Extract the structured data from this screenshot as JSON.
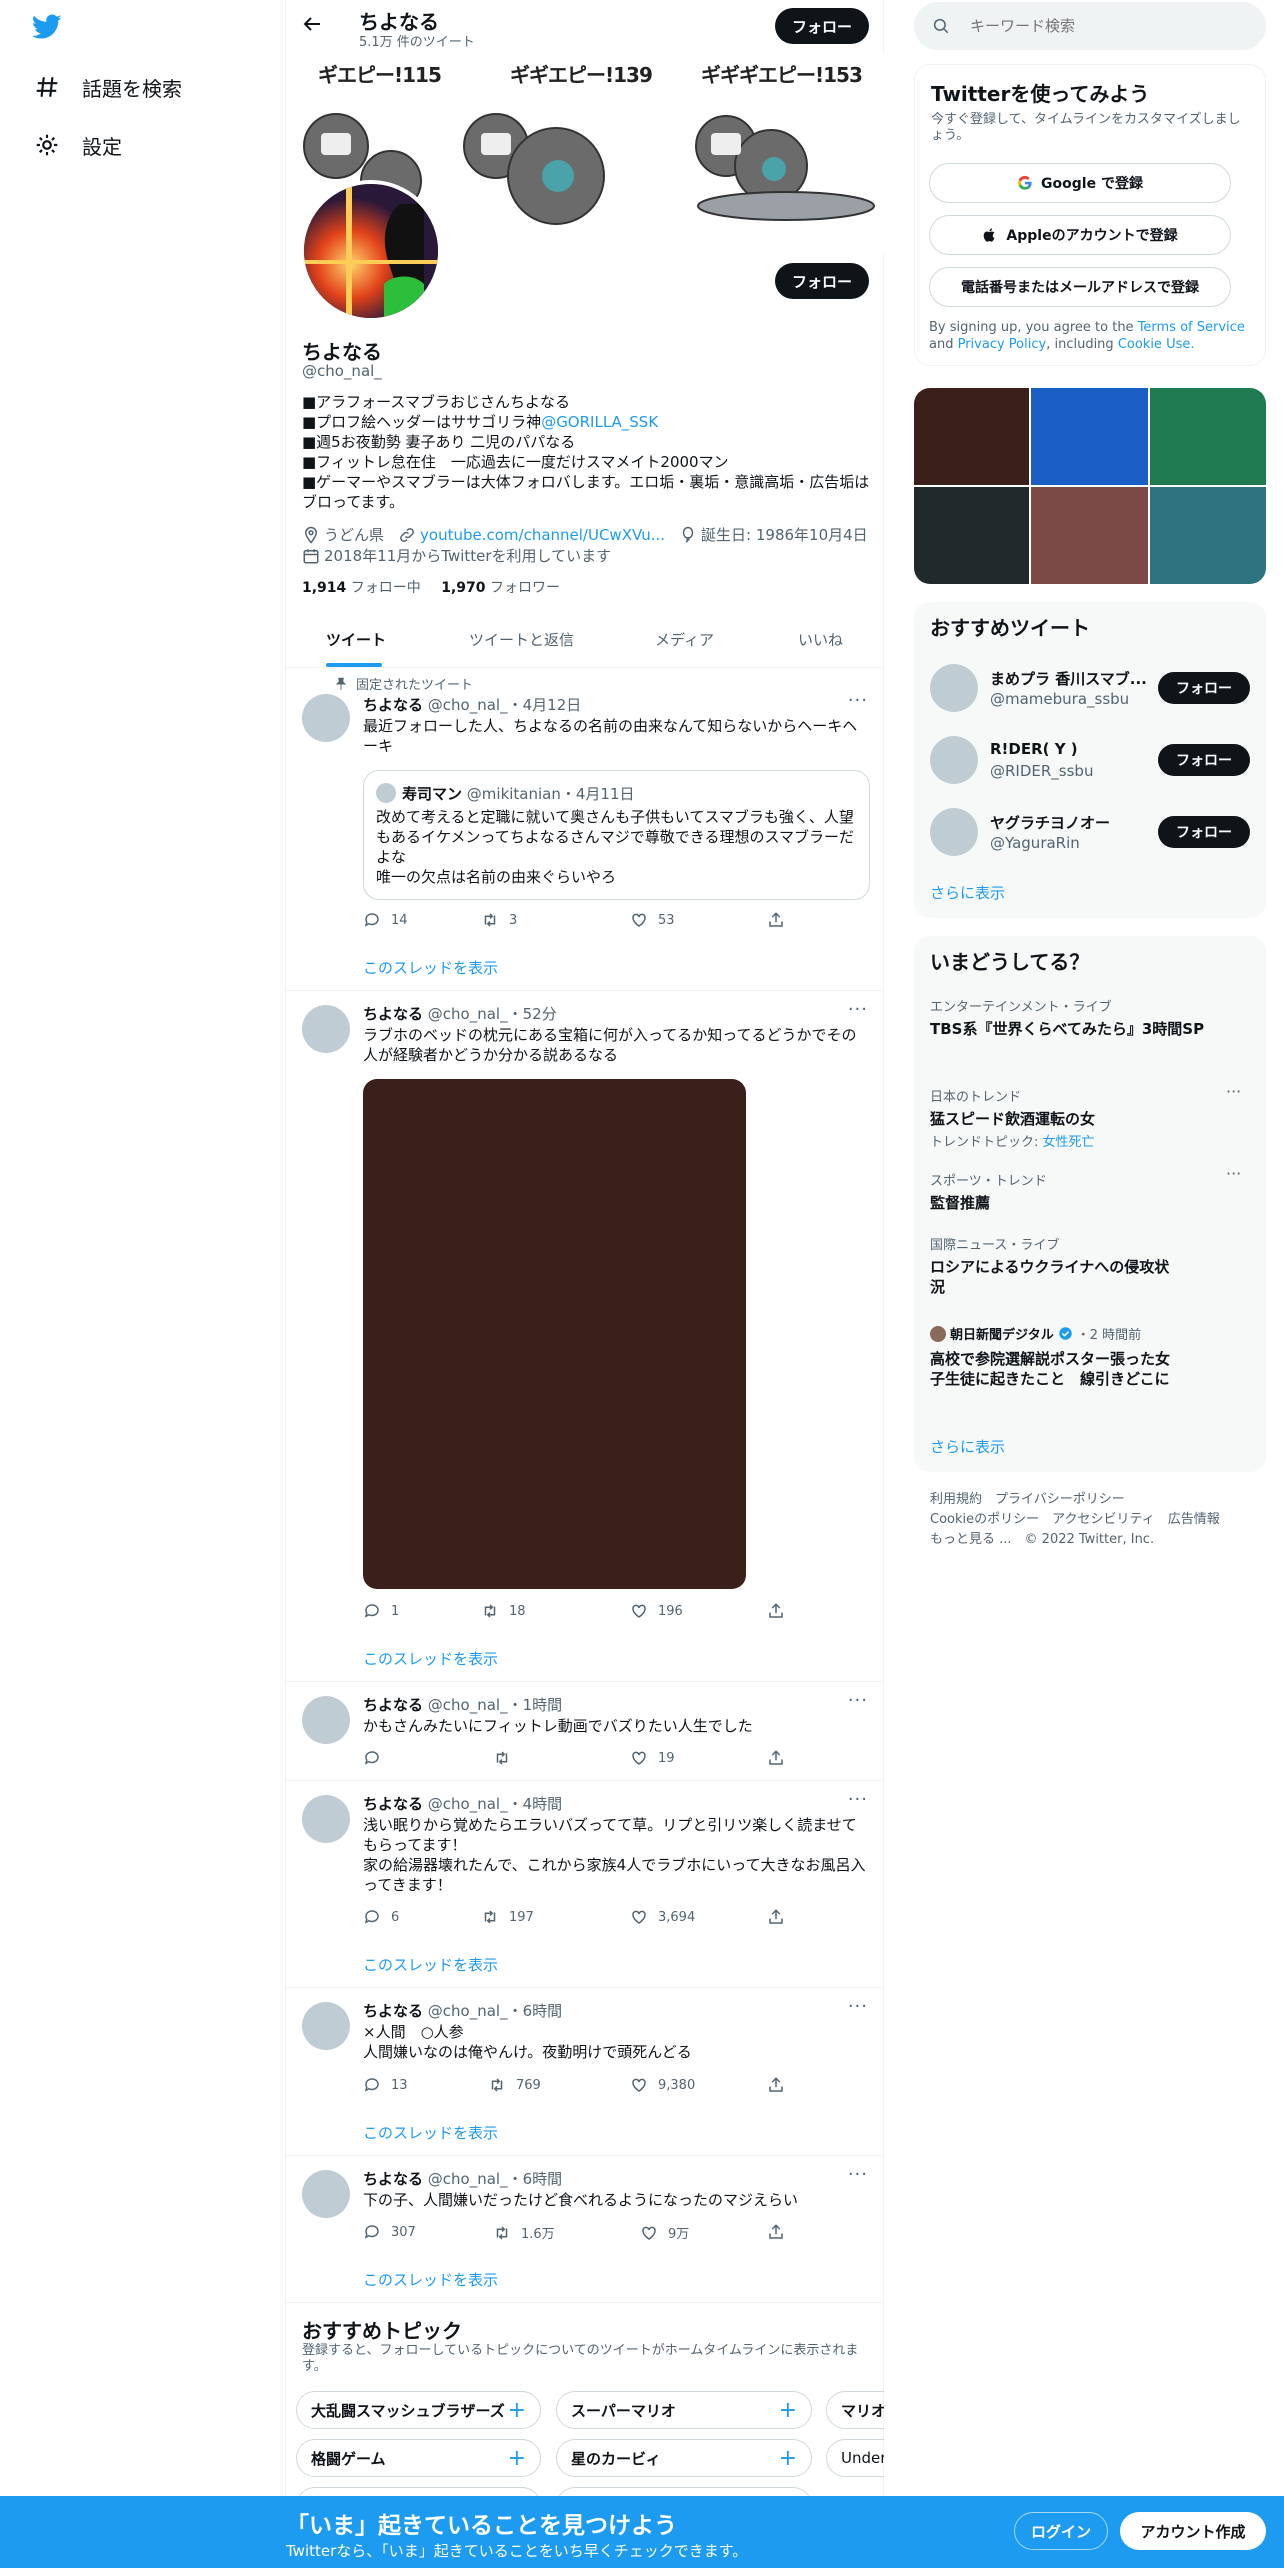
{
  "nav": {
    "explore_label": "話題を検索",
    "settings_label": "設定"
  },
  "header": {
    "name": "ちよなる",
    "tweet_count": "5.1万 件のツイート",
    "follow_label": "フォロー"
  },
  "banner": {
    "labels": [
      "ギエピー!115",
      "ギギエピー!139",
      "ギギギエピー!153"
    ]
  },
  "profile": {
    "name": "ちよなる",
    "handle": "@cho_nal_",
    "follow_label": "フォロー",
    "bio_lines": [
      "■アラフォースマブラおじさんちよなる",
      "■プロフ絵ヘッダーはササゴリラ神",
      "■週5お夜勤勢 妻子あり 二児のパパなる",
      "■フィットレ怠在住　一応過去に一度だけスマメイト2000マン",
      "■ゲーマーやスマブラーは大体フォロバします。エロ垢・裏垢・意識高垢・広告垢はブロってます。"
    ],
    "bio_mention": "@GORILLA_SSK",
    "location": "うどん県",
    "url": "youtube.com/channel/UCwXVu...",
    "birthday": "誕生日: 1986年10月4日",
    "joined": "2018年11月からTwitterを利用しています",
    "following_count": "1,914",
    "following_label": "フォロー中",
    "followers_count": "1,970",
    "followers_label": "フォロワー"
  },
  "tabs": [
    "ツイート",
    "ツイートと返信",
    "メディア",
    "いいね"
  ],
  "pinned_label": "固定されたツイート",
  "thread_label": "このスレッドを表示",
  "tweets": [
    {
      "name": "ちよなる",
      "handle": "@cho_nal_",
      "time": "・4月12日",
      "text": "最近フォローした人、ちよなるの名前の由来なんて知らないからヘーキヘーキ",
      "quote": {
        "name": "寿司マン",
        "handle": "@mikitanian",
        "time": "・4月11日",
        "text1": "改めて考えると定職に就いて奥さんも子供もいてスマブラも強く、人望もあるイケメンってちよなるさんマジで尊敬できる理想のスマブラーだよな",
        "text2": "唯一の欠点は名前の由来ぐらいやろ"
      },
      "replies": "14",
      "retweets": "3",
      "likes": "53"
    },
    {
      "name": "ちよなる",
      "handle": "@cho_nal_",
      "time": "・52分",
      "text": "ラブホのベッドの枕元にある宝箱に何が入ってるか知ってるどうかでその人が経験者かどうか分かる説あるなる",
      "replies": "1",
      "retweets": "18",
      "likes": "196"
    },
    {
      "name": "ちよなる",
      "handle": "@cho_nal_",
      "time": "・1時間",
      "text": "かもさんみたいにフィットレ動画でバズりたい人生でした",
      "replies": "",
      "retweets": "",
      "likes": "19"
    },
    {
      "name": "ちよなる",
      "handle": "@cho_nal_",
      "time": "・4時間",
      "text1": "浅い眠りから覚めたらエラいバズってて草。リプと引リツ楽しく読ませてもらってます！",
      "text2": "家の給湯器壊れたんで、これから家族4人でラブホにいって大きなお風呂入ってきます！",
      "replies": "6",
      "retweets": "197",
      "likes": "3,694"
    },
    {
      "name": "ちよなる",
      "handle": "@cho_nal_",
      "time": "・6時間",
      "text1": "×人間　○人参",
      "text2": "人間嫌いなのは俺やんけ。夜勤明けで頭死んどる",
      "replies": "13",
      "retweets": "769",
      "likes": "9,380"
    },
    {
      "name": "ちよなる",
      "handle": "@cho_nal_",
      "time": "・6時間",
      "text": "下の子、人間嫌いだったけど食べれるようになったのマジえらい",
      "replies": "307",
      "retweets": "1.6万",
      "likes": "9万"
    }
  ],
  "topics": {
    "title": "おすすめトピック",
    "subtitle": "登録すると、フォローしているトピックについてのツイートがホームタイムラインに表示されます。",
    "row1": [
      "大乱闘スマッシュブラザーズ",
      "スーパーマリオ",
      "マリオ"
    ],
    "row2": [
      "格闘ゲーム",
      "星のカービィ",
      "Undert"
    ]
  },
  "search": {
    "placeholder": "キーワード検索"
  },
  "signup": {
    "title": "Twitterを使ってみよう",
    "subtitle": "今すぐ登録して、タイムラインをカスタマイズしましょう。",
    "google": "Google で登録",
    "apple": "Appleのアカウントで登録",
    "phone": "電話番号またはメールアドレスで登録",
    "terms_prefix": "By signing up, you agree to the ",
    "terms": "Terms of Service",
    "and": " and ",
    "privacy": "Privacy Policy",
    "including": ", including ",
    "cookie": "Cookie Use."
  },
  "media_colors": [
    "#3b1f1b",
    "#1c5fc4",
    "#1f7a52",
    "#22292d",
    "#7b4a47",
    "#2f7380"
  ],
  "who_to_follow": {
    "title": "おすすめツイート",
    "users": [
      {
        "name": "まめプラ 香川スマブ...",
        "handle": "@mamebura_ssbu"
      },
      {
        "name": "R!DER( Y )",
        "handle": "@RIDER_ssbu"
      },
      {
        "name": "ヤグラチヨノオー",
        "handle": "@YaguraRin"
      }
    ],
    "follow_label": "フォロー",
    "show_more": "さらに表示"
  },
  "trends": {
    "title": "いまどうしてる？",
    "items": [
      {
        "meta": "エンターテインメント・ライブ",
        "name": "TBS系『世界くらべてみたら』3時間SP"
      },
      {
        "meta": "日本のトレンド",
        "name": "猛スピード飲酒運転の女",
        "sub_prefix": "トレンドトピック: ",
        "sub_link": "女性死亡"
      },
      {
        "meta": "スポーツ・トレンド",
        "name": "監督推薦"
      },
      {
        "meta": "国際ニュース・ライブ",
        "name": "ロシアによるウクライナへの侵攻状況"
      },
      {
        "meta_name": "朝日新聞デジタル",
        "meta_time": "・2 時間前",
        "name": "高校で参院選解説ポスター張った女子生徒に起きたこと　線引きどこに"
      }
    ],
    "show_more": "さらに表示"
  },
  "footer": {
    "row1": [
      "利用規約",
      "プライバシーポリシー"
    ],
    "row2": [
      "Cookieのポリシー",
      "アクセシビリティ",
      "広告情報"
    ],
    "more": "もっと見る ...",
    "copyright": "© 2022 Twitter, Inc."
  },
  "bottom_bar": {
    "headline": "「いま」起きていることを見つけよう",
    "sub": "Twitterなら、「いま」起きていることをいち早くチェックできます。",
    "login": "ログイン",
    "signup": "アカウント作成"
  }
}
